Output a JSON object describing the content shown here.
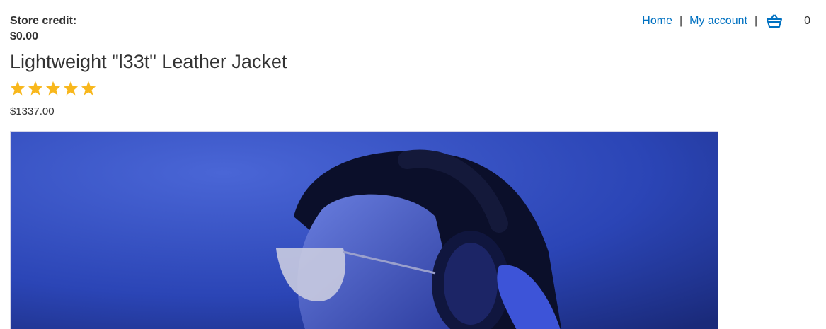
{
  "store_credit": {
    "label": "Store credit:",
    "amount": "$0.00"
  },
  "nav": {
    "home": "Home",
    "separator": "|",
    "my_account": "My account",
    "cart_icon": "basket-icon",
    "cart_count": "0"
  },
  "product": {
    "title": "Lightweight \"l33t\" Leather Jacket",
    "rating": 5,
    "rating_max": 5,
    "price": "$1337.00",
    "image_alt": "person wearing sunglasses and headphones"
  },
  "colors": {
    "link": "#0071c1",
    "star": "#f8b71c",
    "text": "#333333",
    "image_background": "#2a43b8"
  }
}
